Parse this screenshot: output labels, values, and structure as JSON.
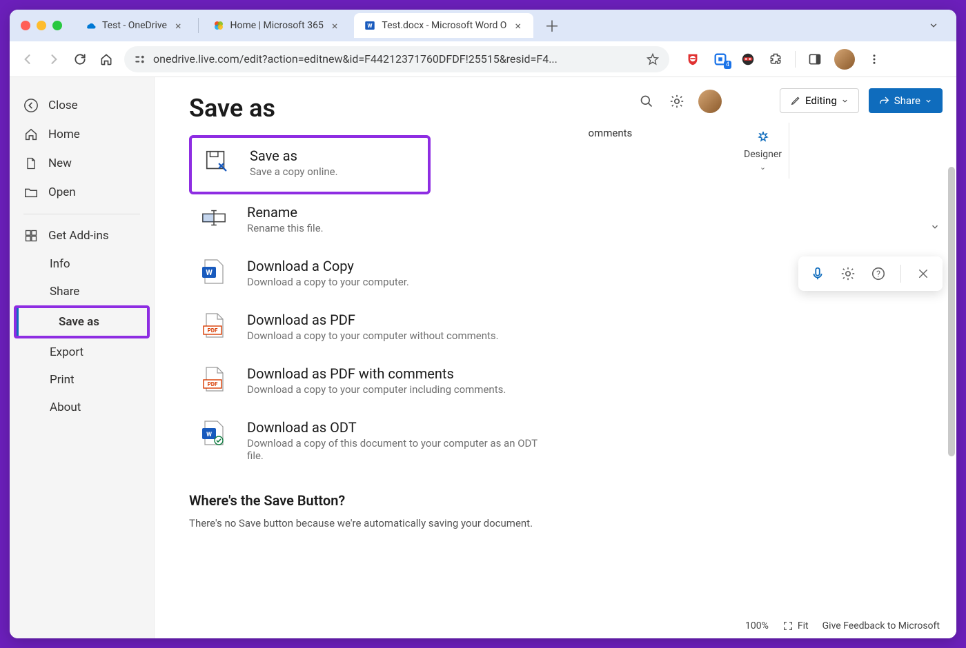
{
  "tabs": [
    {
      "title": "Test - OneDrive",
      "favicon": "onedrive"
    },
    {
      "title": "Home | Microsoft 365",
      "favicon": "m365"
    },
    {
      "title": "Test.docx - Microsoft Word O",
      "favicon": "word",
      "active": true
    }
  ],
  "url": "onedrive.live.com/edit?action=editnew&id=F44212371760DFDF!25515&resid=F4...",
  "header": {
    "comments": "omments",
    "editing": "Editing",
    "share": "Share"
  },
  "sidebar": {
    "close": "Close",
    "home": "Home",
    "new": "New",
    "open": "Open",
    "getaddins": "Get Add-ins",
    "info": "Info",
    "share": "Share",
    "saveas": "Save as",
    "export": "Export",
    "print": "Print",
    "about": "About"
  },
  "page": {
    "title": "Save as",
    "options": [
      {
        "title": "Save as",
        "desc": "Save a copy online.",
        "icon": "saveas"
      },
      {
        "title": "Rename",
        "desc": "Rename this file.",
        "icon": "rename"
      },
      {
        "title": "Download a Copy",
        "desc": "Download a copy to your computer.",
        "icon": "word"
      },
      {
        "title": "Download as PDF",
        "desc": "Download a copy to your computer without comments.",
        "icon": "pdf"
      },
      {
        "title": "Download as PDF with comments",
        "desc": "Download a copy to your computer including comments.",
        "icon": "pdf"
      },
      {
        "title": "Download as ODT",
        "desc": "Download a copy of this document to your computer as an ODT file.",
        "icon": "odt"
      }
    ],
    "info_title": "Where's the Save Button?",
    "info_text": "There's no Save button because we're automatically saving your document."
  },
  "designer": "Designer",
  "status": {
    "zoom": "100%",
    "fit": "Fit",
    "feedback": "Give Feedback to Microsoft"
  },
  "ext_badge": "4"
}
